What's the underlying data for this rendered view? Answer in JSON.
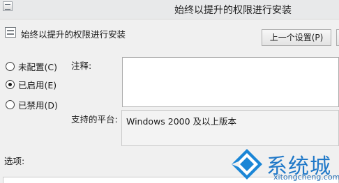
{
  "window": {
    "title": "始终以提升的权限进行安装"
  },
  "header": {
    "policy_title": "始终以提升的权限进行安装",
    "prev_button_label": "上一个设置(P)"
  },
  "radio_options": [
    {
      "label": "未配置(C)",
      "checked": false
    },
    {
      "label": "已启用(E)",
      "checked": true
    },
    {
      "label": "已禁用(D)",
      "checked": false
    }
  ],
  "comment": {
    "label": "注释:",
    "value": ""
  },
  "supported_on": {
    "label": "支持的平台:",
    "value": "Windows 2000 及以上版本"
  },
  "options": {
    "label": "选项:"
  },
  "watermark": {
    "name": "系统城",
    "url": "xitongcheng.com"
  }
}
